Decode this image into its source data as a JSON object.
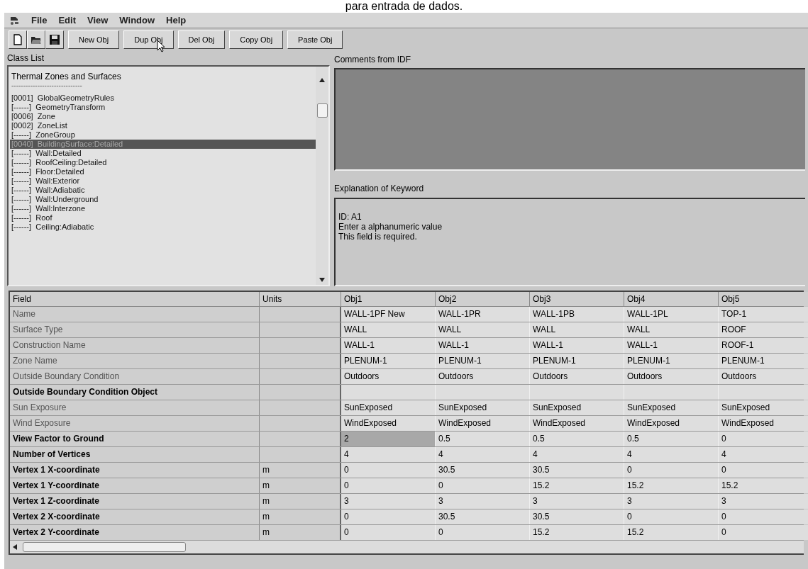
{
  "caption": "para entrada de dados.",
  "menu": [
    "File",
    "Edit",
    "View",
    "Window",
    "Help"
  ],
  "toolbar": {
    "icon_buttons": [
      {
        "kind": "new"
      },
      {
        "kind": "open"
      },
      {
        "kind": "save"
      }
    ],
    "buttons": [
      "New Obj",
      "Dup Obj",
      "Del Obj",
      "Copy Obj",
      "Paste Obj"
    ]
  },
  "class_list": {
    "label": "Class List",
    "heading": "Thermal Zones and Surfaces",
    "separator": "------------------------------",
    "items": [
      {
        "text": "[0001]  GlobalGeometryRules",
        "selected": false
      },
      {
        "text": "[------]  GeometryTransform",
        "selected": false
      },
      {
        "text": "[0006]  Zone",
        "selected": false
      },
      {
        "text": "[0002]  ZoneList",
        "selected": false
      },
      {
        "text": "[------]  ZoneGroup",
        "selected": false
      },
      {
        "text": "[0040]  BuildingSurface:Detailed",
        "selected": true
      },
      {
        "text": "[------]  Wall:Detailed",
        "selected": false
      },
      {
        "text": "[------]  RoofCeiling:Detailed",
        "selected": false
      },
      {
        "text": "[------]  Floor:Detailed",
        "selected": false
      },
      {
        "text": "[------]  Wall:Exterior",
        "selected": false
      },
      {
        "text": "[------]  Wall:Adiabatic",
        "selected": false
      },
      {
        "text": "[------]  Wall:Underground",
        "selected": false
      },
      {
        "text": "[------]  Wall:Interzone",
        "selected": false
      },
      {
        "text": "[------]  Roof",
        "selected": false
      },
      {
        "text": "[------]  Ceiling:Adiabatic",
        "selected": false
      }
    ]
  },
  "comments": {
    "label": "Comments from IDF"
  },
  "explanation": {
    "label": "Explanation of Keyword",
    "lines": [
      "ID: A1",
      "Enter a alphanumeric value",
      "This field is required."
    ]
  },
  "table": {
    "columns": [
      "Field",
      "Units",
      "Obj1",
      "Obj2",
      "Obj3",
      "Obj4",
      "Obj5"
    ],
    "rows": [
      {
        "required": false,
        "cells": [
          {
            "text": "Name",
            "selected": false
          },
          {
            "text": "",
            "selected": false
          },
          {
            "text": "WALL-1PF New",
            "selected": false
          },
          {
            "text": "WALL-1PR",
            "selected": false
          },
          {
            "text": "WALL-1PB",
            "selected": false
          },
          {
            "text": "WALL-1PL",
            "selected": false
          },
          {
            "text": "TOP-1",
            "selected": false
          }
        ]
      },
      {
        "required": false,
        "cells": [
          {
            "text": "Surface Type",
            "selected": false
          },
          {
            "text": "",
            "selected": false
          },
          {
            "text": "WALL",
            "selected": false
          },
          {
            "text": "WALL",
            "selected": false
          },
          {
            "text": "WALL",
            "selected": false
          },
          {
            "text": "WALL",
            "selected": false
          },
          {
            "text": "ROOF",
            "selected": false
          }
        ]
      },
      {
        "required": false,
        "cells": [
          {
            "text": "Construction Name",
            "selected": false
          },
          {
            "text": "",
            "selected": false
          },
          {
            "text": "WALL-1",
            "selected": false
          },
          {
            "text": "WALL-1",
            "selected": false
          },
          {
            "text": "WALL-1",
            "selected": false
          },
          {
            "text": "WALL-1",
            "selected": false
          },
          {
            "text": "ROOF-1",
            "selected": false
          }
        ]
      },
      {
        "required": false,
        "cells": [
          {
            "text": "Zone Name",
            "selected": false
          },
          {
            "text": "",
            "selected": false
          },
          {
            "text": "PLENUM-1",
            "selected": false
          },
          {
            "text": "PLENUM-1",
            "selected": false
          },
          {
            "text": "PLENUM-1",
            "selected": false
          },
          {
            "text": "PLENUM-1",
            "selected": false
          },
          {
            "text": "PLENUM-1",
            "selected": false
          }
        ]
      },
      {
        "required": false,
        "cells": [
          {
            "text": "Outside Boundary Condition",
            "selected": false
          },
          {
            "text": "",
            "selected": false
          },
          {
            "text": "Outdoors",
            "selected": false
          },
          {
            "text": "Outdoors",
            "selected": false
          },
          {
            "text": "Outdoors",
            "selected": false
          },
          {
            "text": "Outdoors",
            "selected": false
          },
          {
            "text": "Outdoors",
            "selected": false
          }
        ]
      },
      {
        "required": true,
        "cells": [
          {
            "text": "Outside Boundary Condition Object",
            "selected": false
          },
          {
            "text": "",
            "selected": false
          },
          {
            "text": "",
            "selected": false
          },
          {
            "text": "",
            "selected": false
          },
          {
            "text": "",
            "selected": false
          },
          {
            "text": "",
            "selected": false
          },
          {
            "text": "",
            "selected": false
          }
        ]
      },
      {
        "required": false,
        "cells": [
          {
            "text": "Sun Exposure",
            "selected": false
          },
          {
            "text": "",
            "selected": false
          },
          {
            "text": "SunExposed",
            "selected": false
          },
          {
            "text": "SunExposed",
            "selected": false
          },
          {
            "text": "SunExposed",
            "selected": false
          },
          {
            "text": "SunExposed",
            "selected": false
          },
          {
            "text": "SunExposed",
            "selected": false
          }
        ]
      },
      {
        "required": false,
        "cells": [
          {
            "text": "Wind Exposure",
            "selected": false
          },
          {
            "text": "",
            "selected": false
          },
          {
            "text": "WindExposed",
            "selected": false
          },
          {
            "text": "WindExposed",
            "selected": false
          },
          {
            "text": "WindExposed",
            "selected": false
          },
          {
            "text": "WindExposed",
            "selected": false
          },
          {
            "text": "WindExposed",
            "selected": false
          }
        ]
      },
      {
        "required": true,
        "cells": [
          {
            "text": "View Factor to Ground",
            "selected": false
          },
          {
            "text": "",
            "selected": false
          },
          {
            "text": "2",
            "selected": true
          },
          {
            "text": "0.5",
            "selected": false
          },
          {
            "text": "0.5",
            "selected": false
          },
          {
            "text": "0.5",
            "selected": false
          },
          {
            "text": "0",
            "selected": false
          }
        ]
      },
      {
        "required": true,
        "cells": [
          {
            "text": "Number of Vertices",
            "selected": false
          },
          {
            "text": "",
            "selected": false
          },
          {
            "text": "4",
            "selected": false
          },
          {
            "text": "4",
            "selected": false
          },
          {
            "text": "4",
            "selected": false
          },
          {
            "text": "4",
            "selected": false
          },
          {
            "text": "4",
            "selected": false
          }
        ]
      },
      {
        "required": true,
        "cells": [
          {
            "text": "Vertex 1 X-coordinate",
            "selected": false
          },
          {
            "text": "m",
            "selected": false
          },
          {
            "text": "0",
            "selected": false
          },
          {
            "text": "30.5",
            "selected": false
          },
          {
            "text": "30.5",
            "selected": false
          },
          {
            "text": "0",
            "selected": false
          },
          {
            "text": "0",
            "selected": false
          }
        ]
      },
      {
        "required": true,
        "cells": [
          {
            "text": "Vertex 1 Y-coordinate",
            "selected": false
          },
          {
            "text": "m",
            "selected": false
          },
          {
            "text": "0",
            "selected": false
          },
          {
            "text": "0",
            "selected": false
          },
          {
            "text": "15.2",
            "selected": false
          },
          {
            "text": "15.2",
            "selected": false
          },
          {
            "text": "15.2",
            "selected": false
          }
        ]
      },
      {
        "required": true,
        "cells": [
          {
            "text": "Vertex 1 Z-coordinate",
            "selected": false
          },
          {
            "text": "m",
            "selected": false
          },
          {
            "text": "3",
            "selected": false
          },
          {
            "text": "3",
            "selected": false
          },
          {
            "text": "3",
            "selected": false
          },
          {
            "text": "3",
            "selected": false
          },
          {
            "text": "3",
            "selected": false
          }
        ]
      },
      {
        "required": true,
        "cells": [
          {
            "text": "Vertex 2 X-coordinate",
            "selected": false
          },
          {
            "text": "m",
            "selected": false
          },
          {
            "text": "0",
            "selected": false
          },
          {
            "text": "30.5",
            "selected": false
          },
          {
            "text": "30.5",
            "selected": false
          },
          {
            "text": "0",
            "selected": false
          },
          {
            "text": "0",
            "selected": false
          }
        ]
      },
      {
        "required": true,
        "cells": [
          {
            "text": "Vertex 2 Y-coordinate",
            "selected": false
          },
          {
            "text": "m",
            "selected": false
          },
          {
            "text": "0",
            "selected": false
          },
          {
            "text": "0",
            "selected": false
          },
          {
            "text": "15.2",
            "selected": false
          },
          {
            "text": "15.2",
            "selected": false
          },
          {
            "text": "0",
            "selected": false
          }
        ]
      }
    ]
  }
}
